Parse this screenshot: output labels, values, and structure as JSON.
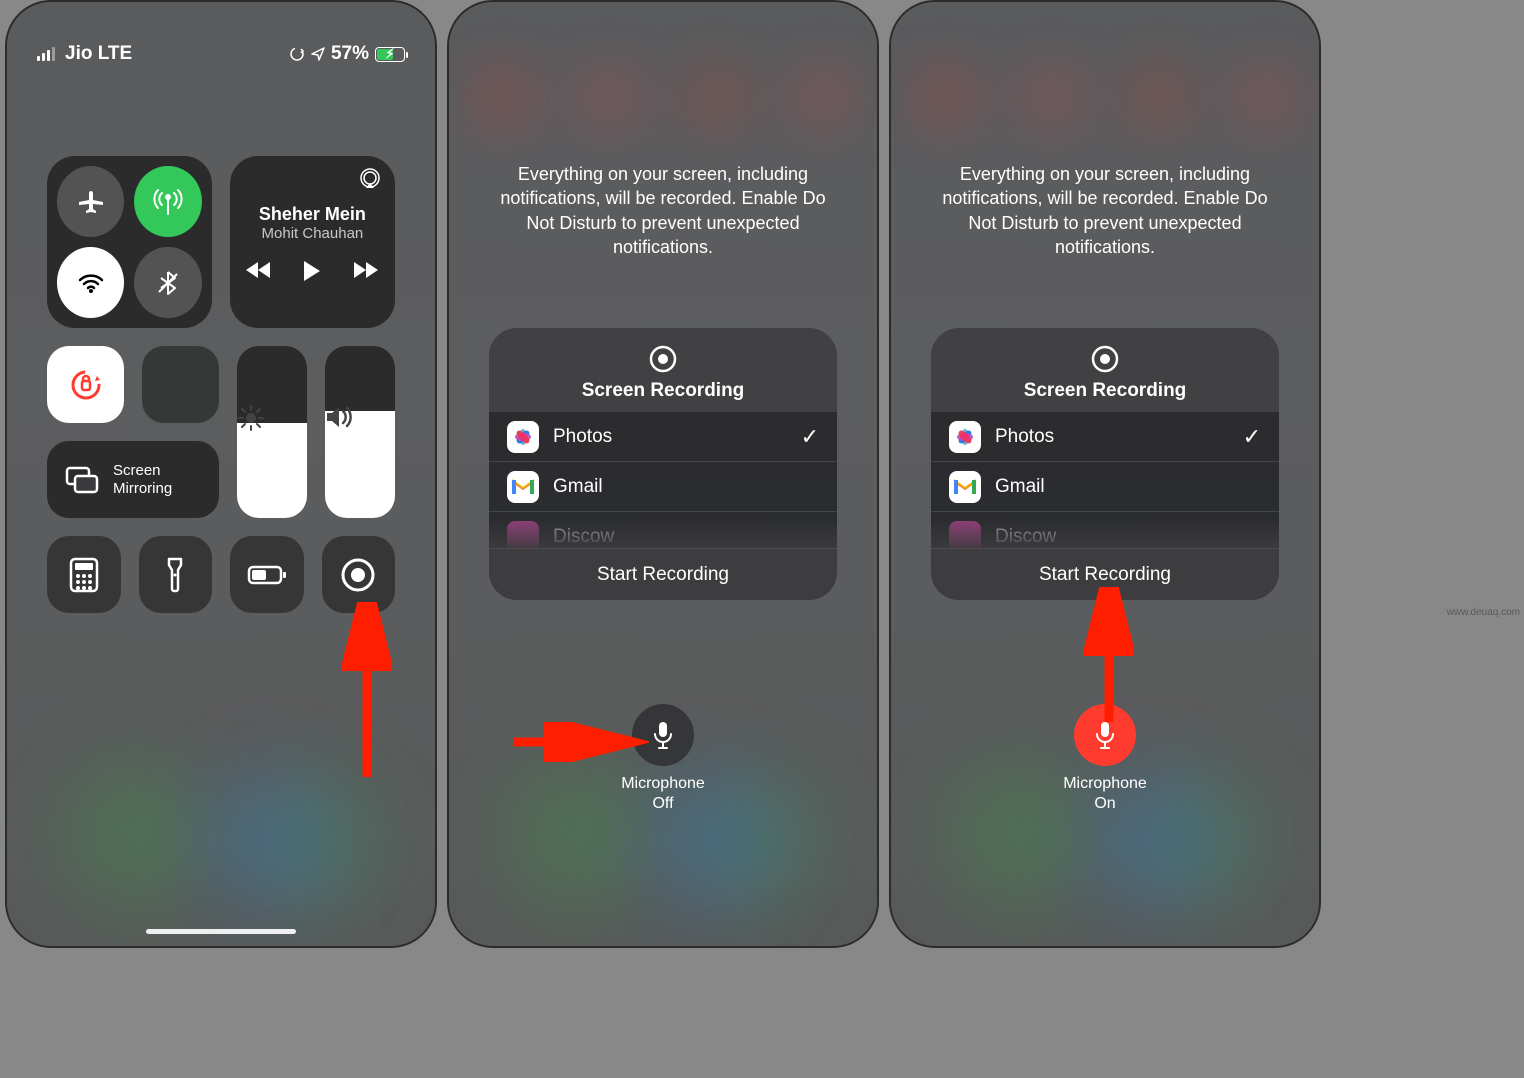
{
  "statusbar": {
    "carrier": "Jio LTE",
    "battery_percent": "57%"
  },
  "music": {
    "title": "Sheher Mein",
    "artist": "Mohit Chauhan"
  },
  "screen_mirroring_label": "Screen\nMirroring",
  "recording_notice": "Everything on your screen, including notifications, will be recorded. Enable Do Not Disturb to prevent unexpected notifications.",
  "sheet": {
    "title": "Screen Recording",
    "destinations": [
      {
        "name": "Photos",
        "selected": true,
        "icon": "photos"
      },
      {
        "name": "Gmail",
        "selected": false,
        "icon": "gmail"
      },
      {
        "name": "Discow",
        "selected": false,
        "icon": "other"
      }
    ],
    "start_label": "Start Recording"
  },
  "mic_off": {
    "label": "Microphone",
    "state": "Off"
  },
  "mic_on": {
    "label": "Microphone",
    "state": "On"
  }
}
